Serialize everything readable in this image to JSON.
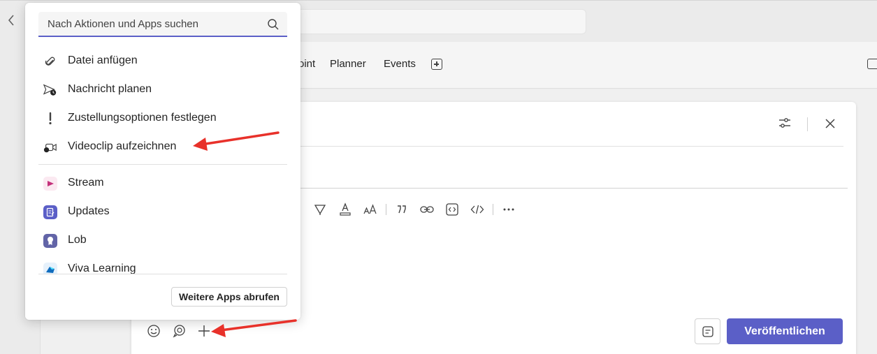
{
  "tabs": [
    {
      "label": "oint"
    },
    {
      "label": "Planner"
    },
    {
      "label": "Events"
    }
  ],
  "popup": {
    "search_placeholder": "Nach Aktionen und Apps suchen",
    "actions": [
      {
        "label": "Datei anfügen",
        "icon": "paperclip-icon"
      },
      {
        "label": "Nachricht planen",
        "icon": "send-clock-icon"
      },
      {
        "label": "Zustellungsoptionen festlegen",
        "icon": "exclamation-icon"
      },
      {
        "label": "Videoclip aufzeichnen",
        "icon": "video-clip-icon"
      }
    ],
    "apps": [
      {
        "label": "Stream",
        "icon": "stream-app-icon",
        "color": "#c4317b"
      },
      {
        "label": "Updates",
        "icon": "updates-app-icon",
        "color": "#5b5fc7"
      },
      {
        "label": "Lob",
        "icon": "praise-app-icon",
        "color": "#6264a7"
      },
      {
        "label": "Viva Learning",
        "icon": "viva-learning-app-icon",
        "color": "#0f6cbd"
      }
    ],
    "more_apps_label": "Weitere Apps abrufen"
  },
  "compose": {
    "publish_label": "Veröffentlichen"
  },
  "colors": {
    "accent": "#5b5fc7",
    "annotation_arrow": "#e8312a"
  }
}
